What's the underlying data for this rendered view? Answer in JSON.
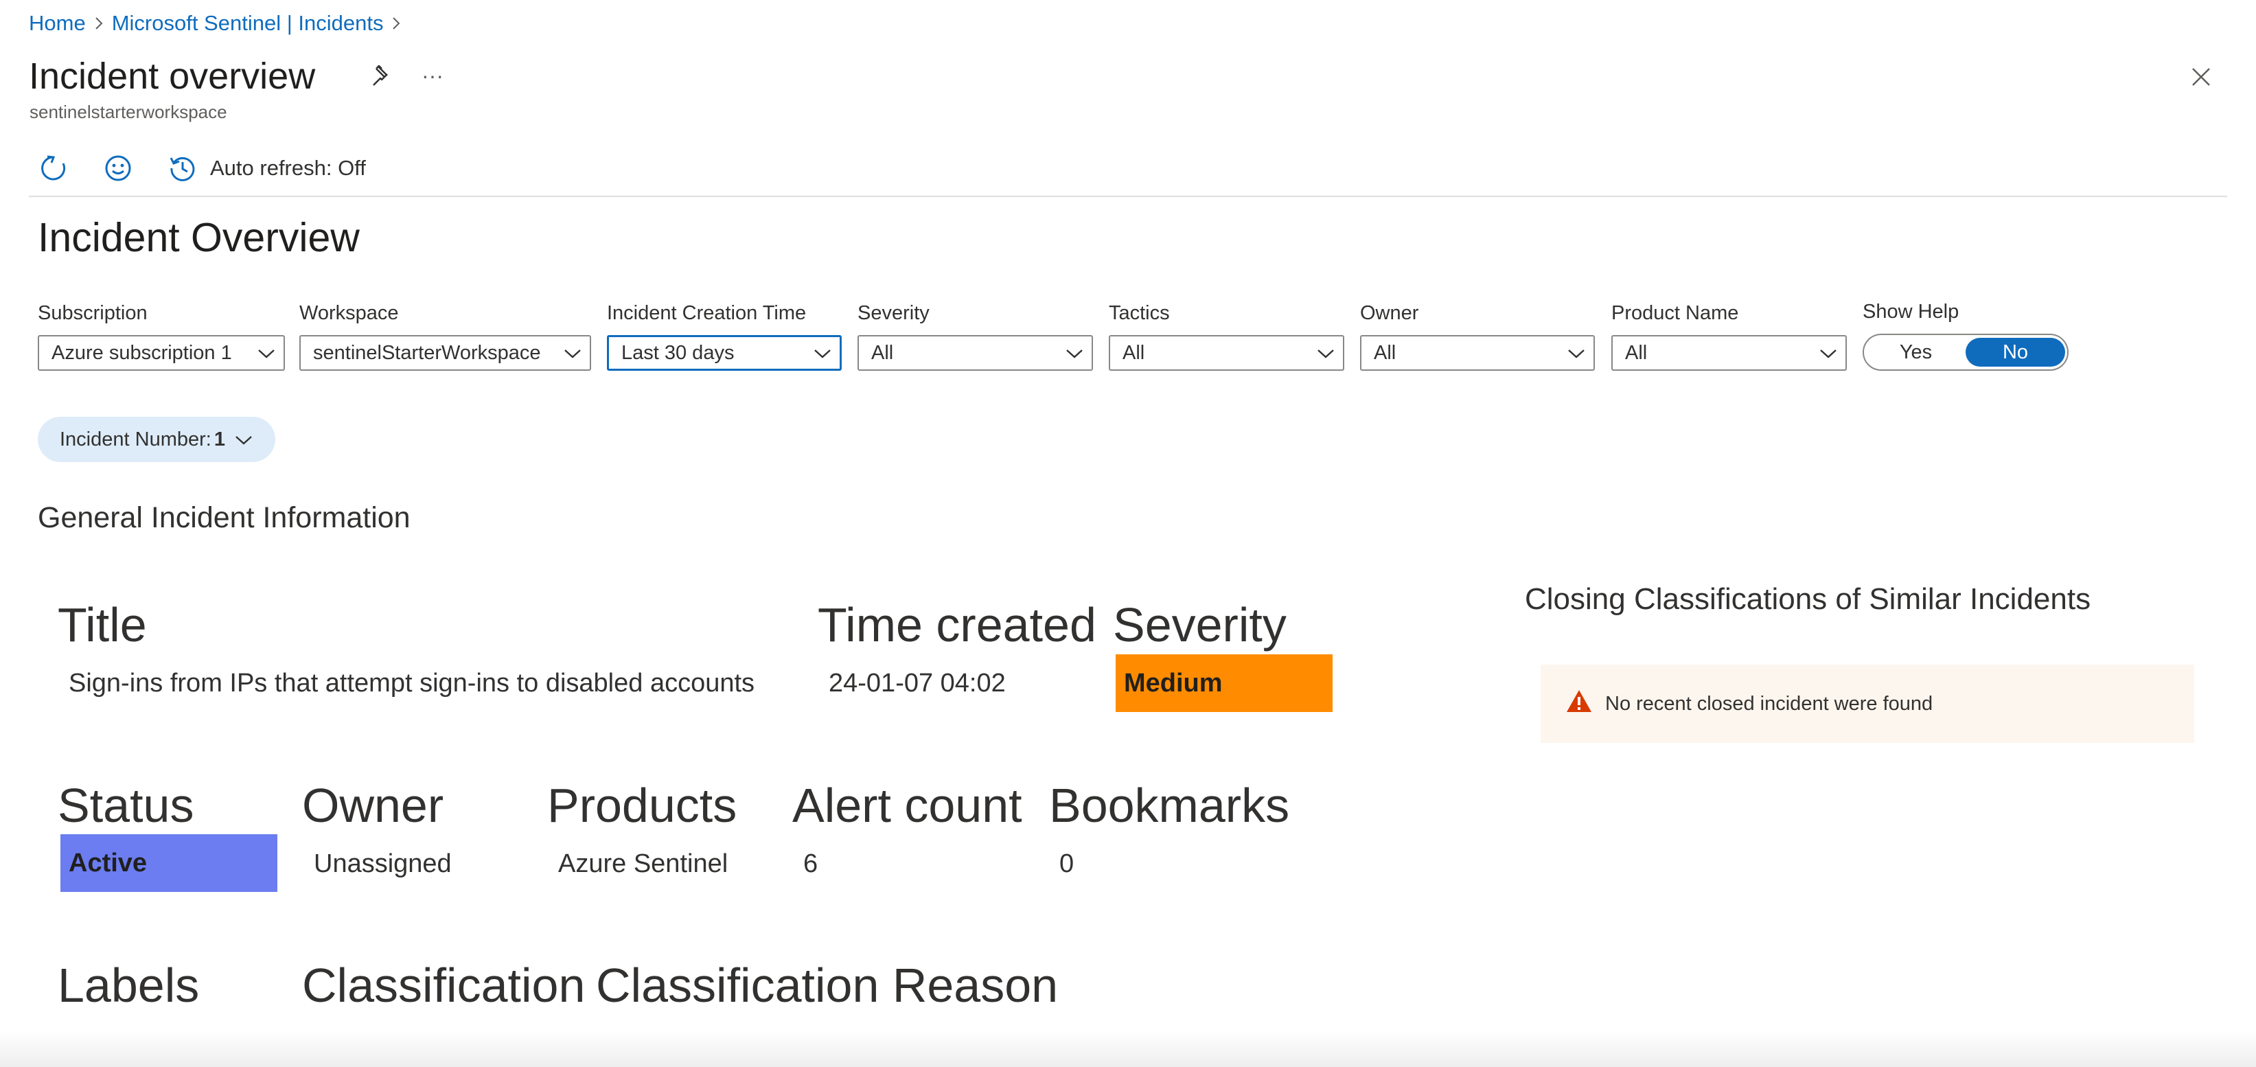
{
  "breadcrumb": {
    "home": "Home",
    "incidents": "Microsoft Sentinel | Incidents"
  },
  "blade": {
    "title": "Incident overview",
    "subtitle": "sentinelstarterworkspace",
    "more": "···"
  },
  "toolbar": {
    "auto_refresh": "Auto refresh: Off"
  },
  "workbook": {
    "title": "Incident Overview"
  },
  "params": {
    "subscription": {
      "label": "Subscription",
      "value": "Azure subscription 1"
    },
    "workspace": {
      "label": "Workspace",
      "value": "sentinelStarterWorkspace"
    },
    "creation_time": {
      "label": "Incident Creation Time",
      "value": "Last 30 days"
    },
    "severity": {
      "label": "Severity",
      "value": "All"
    },
    "tactics": {
      "label": "Tactics",
      "value": "All"
    },
    "owner": {
      "label": "Owner",
      "value": "All"
    },
    "product_name": {
      "label": "Product Name",
      "value": "All"
    },
    "show_help": {
      "label": "Show Help",
      "yes": "Yes",
      "no": "No",
      "selected": "No"
    }
  },
  "incident_number": {
    "label": "Incident Number:",
    "value": "1"
  },
  "general": {
    "heading": "General Incident Information"
  },
  "incident": {
    "title_label": "Title",
    "title_value": "Sign-ins from IPs that attempt sign-ins to disabled accounts",
    "time_label": "Time created",
    "time_value": "24-01-07 04:02",
    "severity_label": "Severity",
    "severity_value": "Medium",
    "status_label": "Status",
    "status_value": "Active",
    "owner_label": "Owner",
    "owner_value": "Unassigned",
    "products_label": "Products",
    "products_value": "Azure Sentinel",
    "alert_count_label": "Alert count",
    "alert_count_value": "6",
    "bookmarks_label": "Bookmarks",
    "bookmarks_value": "0",
    "labels_label": "Labels",
    "classification_label": "Classification",
    "classification_reason_label": "Classification Reason"
  },
  "closing": {
    "title": "Closing Classifications of Similar Incidents",
    "notice": "No recent closed incident were found"
  },
  "colors": {
    "accent": "#0f6cbd",
    "severity_medium": "#ff8c00",
    "status_active": "#6b7df0",
    "warning": "#d83b01"
  },
  "icons": [
    "chevron-right-icon",
    "pin-icon",
    "more-icon",
    "close-icon",
    "refresh-icon",
    "smiley-icon",
    "history-icon",
    "chevron-down-icon",
    "warning-icon"
  ]
}
